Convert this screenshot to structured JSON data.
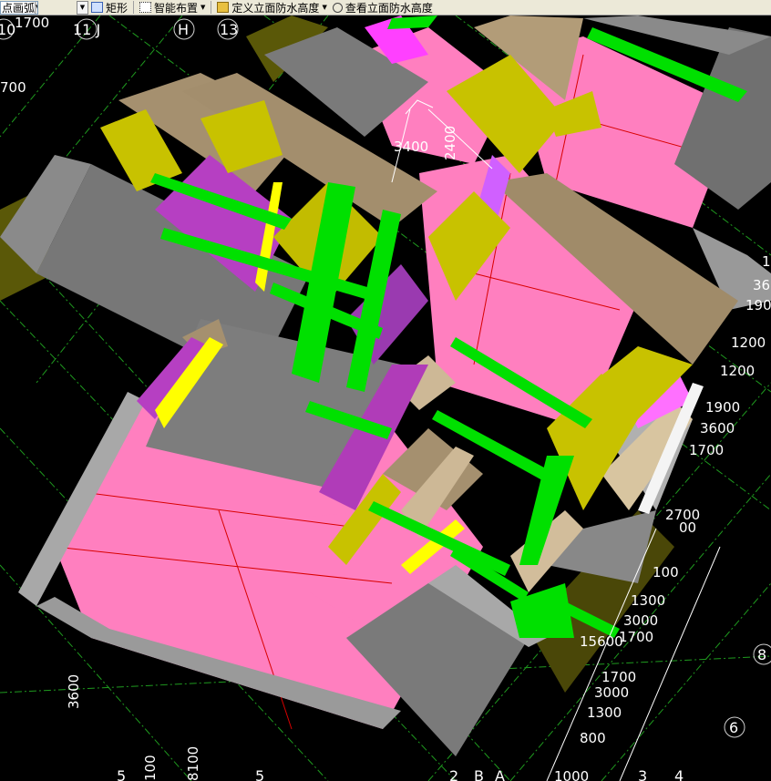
{
  "toolbar": {
    "arc_mode": "点画弧",
    "rect_label": "矩形",
    "smart_layout_label": "智能布置",
    "define_height_label": "定义立面防水高度",
    "view_height_label": "查看立面防水高度"
  },
  "axis_labels": {
    "a10": "10",
    "a11j": "11 J",
    "ah": "H",
    "a13": "13",
    "a8": "8",
    "a6": "6",
    "a5": "5",
    "a5b": "5",
    "a4": "4",
    "a3": "3",
    "a2": "2",
    "aa": "A",
    "ab": "B"
  },
  "dimensions": {
    "d1700top": "1700",
    "d700left": "700",
    "d3400": "3400",
    "d2400": "2400",
    "d36": "36",
    "d190": "190",
    "d1200a": "1200",
    "d1200b": "1200",
    "d1900": "1900",
    "d3600r": "3600",
    "d1700r": "1700",
    "d2700": "2700",
    "d00": "00",
    "d100": "100",
    "d1300a": "1300",
    "d3000a": "3000",
    "d1700b": "1700",
    "d15600": "15600",
    "d1700c": "1700",
    "d3000b": "3000",
    "d1300b": "1300",
    "d800": "800",
    "d3600l": "3600",
    "d8100": "8100",
    "d100b": "100",
    "d1000": "1000",
    "d1r": "1"
  }
}
